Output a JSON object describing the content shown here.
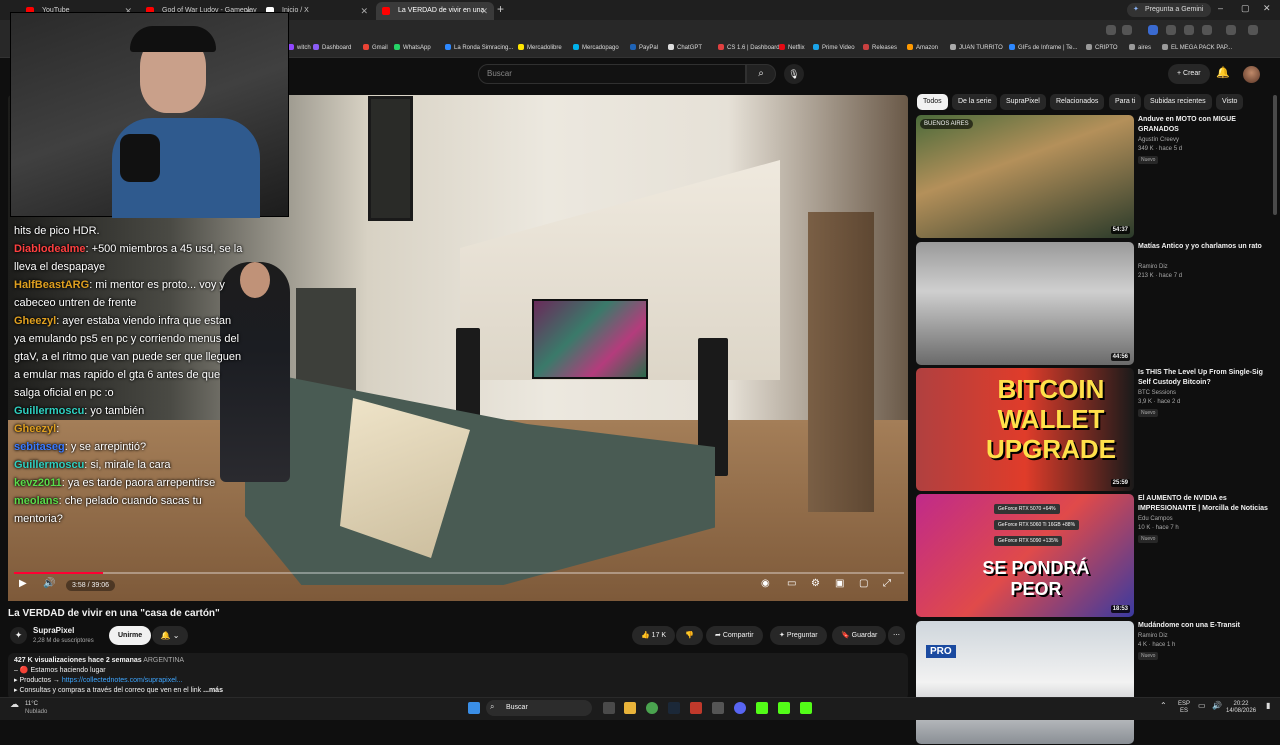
{
  "browser": {
    "tabs": [
      {
        "title": "YouTube",
        "color": "#ff0000"
      },
      {
        "title": "God of War Ludov - Gameplay",
        "color": "#ff0000"
      },
      {
        "title": "Inicio / X",
        "color": "#ffffff"
      },
      {
        "title": "La VERDAD de vivir en una",
        "color": "#ff0000"
      }
    ],
    "gemini_button": "Pregunta a Gemini",
    "bookmarks": [
      {
        "label": "witch",
        "color": "#9146ff"
      },
      {
        "label": "Dashboard",
        "color": "#8a5cf6"
      },
      {
        "label": "Gmail",
        "color": "#ea4335"
      },
      {
        "label": "WhatsApp",
        "color": "#25d366"
      },
      {
        "label": "La Ronda Simracing...",
        "color": "#2d88ff"
      },
      {
        "label": "Mercadolibre",
        "color": "#ffe600"
      },
      {
        "label": "Mercadopago",
        "color": "#00b1ea"
      },
      {
        "label": "PayPal",
        "color": "#1e63b6"
      },
      {
        "label": "ChatGPT",
        "color": "#dddddd"
      },
      {
        "label": "CS 1.6 | Dashboard",
        "color": "#e04040"
      },
      {
        "label": "Netflix",
        "color": "#e50914"
      },
      {
        "label": "Prime Video",
        "color": "#1aa3e8"
      },
      {
        "label": "Releases",
        "color": "#c94040"
      },
      {
        "label": "Amazon",
        "color": "#ff9900"
      },
      {
        "label": "JUAN TURRITO",
        "color": "#aaaaaa"
      },
      {
        "label": "GIFs de Inframe | Te...",
        "color": "#2d88ff"
      },
      {
        "label": "CRIPTO",
        "color": "#999999"
      },
      {
        "label": "aires",
        "color": "#999999"
      },
      {
        "label": "EL MEGA PACK PAP...",
        "color": "#999999"
      }
    ]
  },
  "youtube": {
    "search_placeholder": "Buscar",
    "create_label": "Crear"
  },
  "chat": [
    {
      "user": "",
      "text": "hits de pico HDR.",
      "color": "#ffffff"
    },
    {
      "user": "Diablodealme",
      "text": ": +500 miembros a 45 usd, se la lleva el despapaye",
      "color": "#ff4040"
    },
    {
      "user": "HalfBeastARG",
      "text": ": mi mentor es proto... voy y cabeceo untren de frente",
      "color": "#e0a020"
    },
    {
      "user": "Gheezyl",
      "text": ": ayer estaba viendo infra que estan ya emulando ps5 en pc y corriendo menus del gtaV, a el ritmo que van puede ser que lleguen a emular mas rapido el gta 6 antes de que salga oficial en pc :o",
      "color": "#e0a020"
    },
    {
      "user": "Guillermoscu",
      "text": ": yo también",
      "color": "#2ed0c0"
    },
    {
      "user": "Gheezyl",
      "text": ": ",
      "color": "#e0a020"
    },
    {
      "user": "sebitaseg",
      "text": ": y se arrepintió?",
      "color": "#3a7aff"
    },
    {
      "user": "Guillermoscu",
      "text": ": si, mirale la cara",
      "color": "#2ed0c0"
    },
    {
      "user": "kevz2011",
      "text": ": ya es tarde paora arrepentirse",
      "color": "#5adc4a"
    },
    {
      "user": "meolans",
      "text": ": che pelado cuando sacas tu mentoria?",
      "color": "#5adc4a"
    }
  ],
  "player": {
    "time": "3:58 / 39:06",
    "progress": 0.1
  },
  "video": {
    "title": "La VERDAD de vivir en una \"casa de cartón\"",
    "channel": "SupraPixel",
    "subscribers": "2,28 M de suscriptores",
    "join_label": "Unirme",
    "likes": "17 K",
    "share": "Compartir",
    "ask": "Preguntar",
    "save": "Guardar",
    "views_line": "427 K visualizaciones  hace 2 semanas",
    "location": "ARGENTINA",
    "desc_line1": "Estamos haciendo lugar",
    "desc_line2_prefix": "Productos →",
    "desc_link": "https://collectednotes.com/suprapixel...",
    "desc_line3": "Consultas y compras a través del correo que ven en el link",
    "more": "...más"
  },
  "chips": [
    "Todos",
    "De la serie",
    "SupraPixel",
    "Relacionados",
    "Para ti",
    "Subidas recientes",
    "Visto"
  ],
  "recommendations": [
    {
      "title": "Anduve en MOTO con MIGUE GRANADOS",
      "channel": "Agustín Creevy",
      "meta": "349 K · hace 5 d",
      "badge": "Nuevo",
      "duration": "54:37",
      "overlay": "BUENOS AIRES"
    },
    {
      "title": "Matías Antico y yo charlamos un rato",
      "channel": "Ramiro Diz",
      "meta": "213 K · hace 7 d",
      "badge": "",
      "duration": "44:56",
      "overlay": ""
    },
    {
      "title": "Is THIS The Level Up From Single-Sig Self Custody Bitcoin?",
      "channel": "BTC Sessions",
      "meta": "3,9 K · hace 2 d",
      "badge": "Nuevo",
      "duration": "25:59",
      "overlay": "BITCOIN WALLET UPGRADE"
    },
    {
      "title": "El AUMENTO de NVIDIA es IMPRESIONANTE | Morcilla de Noticias",
      "channel": "Edu Campos",
      "meta": "10 K · hace 7 h",
      "badge": "Nuevo",
      "duration": "18:53",
      "overlay": "SE PONDRÁ PEOR"
    },
    {
      "title": "Mudándome con una E-Transit",
      "channel": "Ramiro Diz",
      "meta": "4 K · hace 1 h",
      "badge": "Nuevo",
      "duration": "",
      "overlay": "PRO"
    }
  ],
  "nvidia_rows": [
    "GeForce RTX 5070  +64%",
    "GeForce RTX 5060 Ti 16GB  +88%",
    "GeForce RTX 5090  +135%"
  ],
  "taskbar": {
    "weather_temp": "11°C",
    "weather_desc": "Nublado",
    "search": "Buscar",
    "lang1": "ESP",
    "lang2": "ES",
    "time": "20:22",
    "date": "14/08/2026"
  }
}
